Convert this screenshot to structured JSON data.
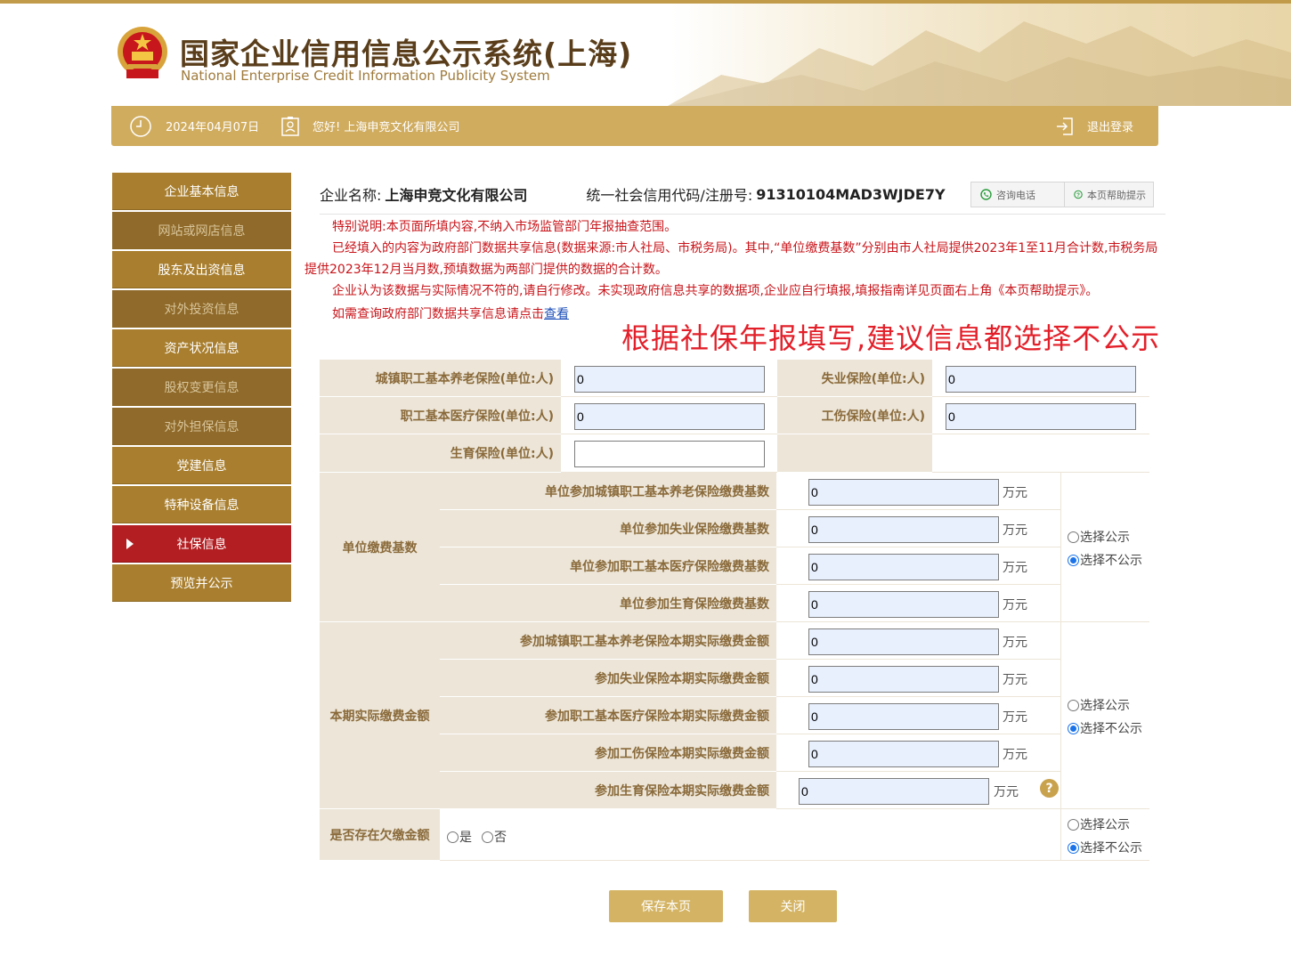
{
  "header": {
    "title": "国家企业信用信息公示系统(上海)",
    "subtitle": "National Enterprise Credit Information Publicity System"
  },
  "status": {
    "date": "2024年04月07日",
    "greeting": "您好! 上海申竞文化有限公司",
    "logout": "退出登录"
  },
  "sidebar": {
    "items": [
      {
        "label": "企业基本信息"
      },
      {
        "label": "网站或网店信息"
      },
      {
        "label": "股东及出资信息"
      },
      {
        "label": "对外投资信息"
      },
      {
        "label": "资产状况信息"
      },
      {
        "label": "股权变更信息"
      },
      {
        "label": "对外担保信息"
      },
      {
        "label": "党建信息"
      },
      {
        "label": "特种设备信息"
      },
      {
        "label": "社保信息"
      },
      {
        "label": "预览并公示"
      }
    ]
  },
  "enterprise": {
    "name_label": "企业名称:",
    "name": "上海申竞文化有限公司",
    "code_label": "统一社会信用代码/注册号:",
    "code": "91310104MAD3WJDE7Y"
  },
  "toolbar": {
    "consult": "咨询电话",
    "help": "本页帮助提示"
  },
  "notice": {
    "line1": "特别说明:本页面所填内容,不纳入市场监管部门年报抽查范围。",
    "line2": "已经填入的内容为政府部门数据共享信息(数据来源:市人社局、市税务局)。其中,“单位缴费基数”分别由市人社局提供2023年1至11月合计数,市税务局提供2023年12月当月数,预填数据为两部门提供的数据的合计数。",
    "line3": "企业认为该数据与实际情况不符的,请自行修改。未实现政府信息共享的数据项,企业应自行填报,填报指南详见页面右上角《本页帮助提示》。",
    "line4": "如需查询政府部门数据共享信息请点击",
    "link": "查看",
    "annotation": "根据社保年报填写,建议信息都选择不公示"
  },
  "insured": {
    "pension_label": "城镇职工基本养老保险(单位:人)",
    "pension": "0",
    "unemployment_label": "失业保险(单位:人)",
    "unemployment": "0",
    "medical_label": "职工基本医疗保险(单位:人)",
    "medical": "0",
    "injury_label": "工伤保险(单位:人)",
    "injury": "0",
    "maternity_label": "生育保险(单位:人)",
    "maternity": ""
  },
  "base": {
    "group_label": "单位缴费基数",
    "rows": [
      {
        "label": "单位参加城镇职工基本养老保险缴费基数",
        "value": "0",
        "unit": "万元"
      },
      {
        "label": "单位参加失业保险缴费基数",
        "value": "0",
        "unit": "万元"
      },
      {
        "label": "单位参加职工基本医疗保险缴费基数",
        "value": "0",
        "unit": "万元"
      },
      {
        "label": "单位参加生育保险缴费基数",
        "value": "0",
        "unit": "万元"
      }
    ],
    "public": "选择公示",
    "private": "选择不公示"
  },
  "actual": {
    "group_label": "本期实际缴费金额",
    "rows": [
      {
        "label": "参加城镇职工基本养老保险本期实际缴费金额",
        "value": "0",
        "unit": "万元"
      },
      {
        "label": "参加失业保险本期实际缴费金额",
        "value": "0",
        "unit": "万元"
      },
      {
        "label": "参加职工基本医疗保险本期实际缴费金额",
        "value": "0",
        "unit": "万元"
      },
      {
        "label": "参加工伤保险本期实际缴费金额",
        "value": "0",
        "unit": "万元"
      },
      {
        "label": "参加生育保险本期实际缴费金额",
        "value": "0",
        "unit": "万元"
      }
    ],
    "public": "选择公示",
    "private": "选择不公示"
  },
  "arrears": {
    "label": "是否存在欠缴金额",
    "yes": "是",
    "no": "否",
    "public": "选择公示",
    "private": "选择不公示"
  },
  "actions": {
    "save": "保存本页",
    "close": "关闭"
  }
}
